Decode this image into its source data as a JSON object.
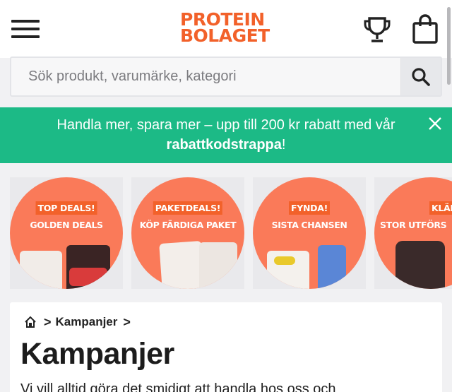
{
  "header": {
    "logo_line1": "PROTEIN",
    "logo_line2": "BOLAGET",
    "menu_icon": "hamburger-menu-icon",
    "trophy_icon": "trophy-icon",
    "cart_icon": "shopping-bag-icon",
    "brand_color": "#f2612a"
  },
  "search": {
    "placeholder": "Sök produkt, varumärke, kategori",
    "icon": "search-icon"
  },
  "banner": {
    "text_before": "Handla mer, spara mer – upp till 200 kr rabatt med vår",
    "link_text": "rabattkodstrappa",
    "text_after": "!",
    "close_icon": "close-icon",
    "background": "#1cba86"
  },
  "deals": [
    {
      "tag": "TOP DEALS!",
      "subtitle": "GOLDEN DEALS"
    },
    {
      "tag": "PAKETDEALS!",
      "subtitle": "KÖP FÄRDIGA PAKET"
    },
    {
      "tag": "FYNDA!",
      "subtitle": "SISTA CHANSEN"
    },
    {
      "tag": "KLÄDRE",
      "subtitle": "STOR UTFÖRS"
    }
  ],
  "breadcrumb": {
    "home_icon": "home-icon",
    "sep": ">",
    "current": "Kampanjer",
    "trailing_sep": ">"
  },
  "page": {
    "title": "Kampanjer",
    "intro": "Vi vill alltid göra det smidigt att handla hos oss och"
  }
}
